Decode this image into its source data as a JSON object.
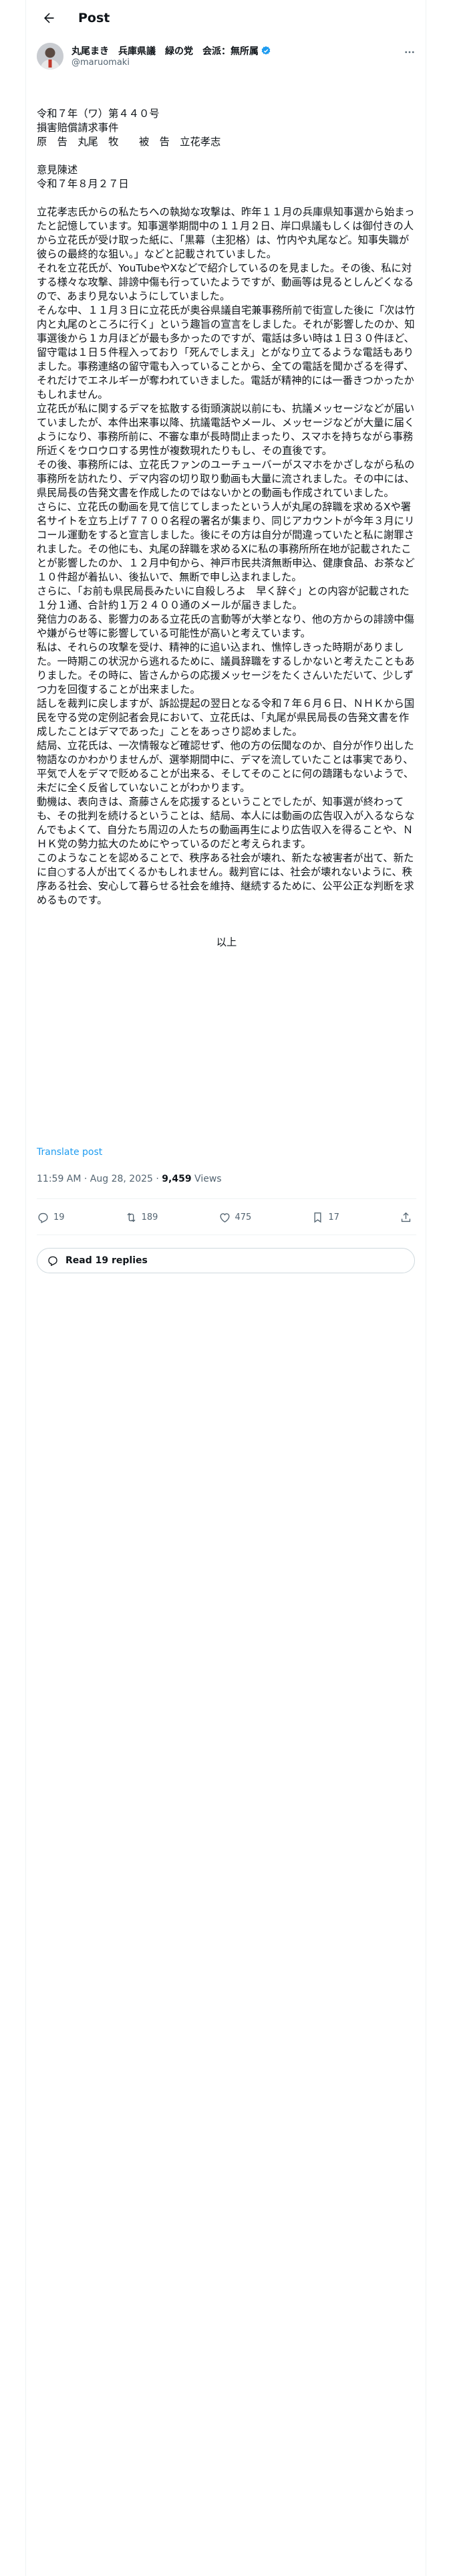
{
  "header": {
    "title": "Post"
  },
  "author": {
    "display_name": "丸尾まき　兵庫県議　緑の党　会派：無所属",
    "handle": "@maruomaki"
  },
  "post": {
    "text": "令和７年（ワ）第４４０号\n損害賠償請求事件\n原　告　丸尾　牧　　被　告　立花孝志\n\n意見陳述\n令和７年８月２７日\n\n立花孝志氏からの私たちへの執拗な攻撃は、昨年１１月の兵庫県知事選から始まったと記憶しています。知事選挙期間中の１１月２日、岸口県議もしくは御付きの人から立花氏が受け取った紙に、「黒幕（主犯格）は、竹内や丸尾など。知事失職が彼らの最終的な狙い。」などと記載されていました。\nそれを立花氏が、YouTubeやXなどで紹介しているのを見ました。その後、私に対する様々な攻撃、誹謗中傷も行っていたようですが、動画等は見るとしんどくなるので、あまり見ないようにしていました。\nそんな中、１１月３日に立花氏が奥谷県議自宅兼事務所前で街宣した後に「次は竹内と丸尾のところに行く」という趣旨の宣言をしました。それが影響したのか、知事選後から１カ月ほどが最も多かったのですが、電話は多い時は１日３０件ほど、留守電は１日５件程入っており「死んでしまえ」とがなり立てるような電話もありました。事務連絡の留守電も入っていることから、全ての電話を聞かざるを得ず、それだけでエネルギーが奪われていきました。電話が精神的には一番きつかったかもしれません。\n立花氏が私に関するデマを拡散する街頭演説以前にも、抗議メッセージなどが届いていましたが、本件出来事以降、抗議電話やメール、メッセージなどが大量に届くようになり、事務所前に、不審な車が長時間止まったり、スマホを持ちながら事務所近くをウロウロする男性が複数現れたりもし、その直後です。\nその後、事務所には、立花氏ファンのユーチューバーがスマホをかざしながら私の事務所を訪れたり、デマ内容の切り取り動画も大量に流されました。その中には、県民局長の告発文書を作成したのではないかとの動画も作成されていました。\nさらに、立花氏の動画を見て信じてしまったという人が丸尾の辞職を求めるXや署名サイトを立ち上げ７７００名程の署名が集まり、同じアカウントが今年３月にリコール運動をすると宣言しました。後にその方は自分が間違っていたと私に謝罪されました。その他にも、丸尾の辞職を求めるXに私の事務所所在地が記載されたことが影響したのか、１２月中旬から、神戸市民共済無断申込、健康食品、お茶など１０件超が着払い、後払いで、無断で申し込まれました。\nさらに、「お前も県民局長みたいに自殺しろよ　早く辞ぐ」との内容が記載された１分１通、合計約１万２４００通のメールが届きました。\n発信力のある、影響力のある立花氏の言動等が大挙となり、他の方からの誹謗中傷や嫌がらせ等に影響している可能性が高いと考えています。\n私は、それらの攻撃を受け、精神的に追い込まれ、憔悴しきった時期がありました。一時期この状況から逃れるために、議員辞職をするしかないと考えたこともありました。その時に、皆さんからの応援メッセージをたくさんいただいて、少しずつ力を回復することが出来ました。\n話しを裁判に戻しますが、訴訟提起の翌日となる令和７年６月６日、ＮＨＫから国民を守る党の定例記者会見において、立花氏は、「丸尾が県民局長の告発文書を作成したことはデマであった」ことをあっさり認めました。\n結局、立花氏は、一次情報など確認せず、他の方の伝聞なのか、自分が作り出した物語なのかわかりませんが、選挙期間中に、デマを流していたことは事実であり、平気で人をデマで貶めることが出来る、そしてそのことに何の躊躇もないようで、未だに全く反省していないことがわかります。\n動機は、表向きは、斎藤さんを応援するということでしたが、知事選が終わっても、その批判を続けるということは、結局、本人には動画の広告収入が入るならなんでもよくて、自分たち周辺の人たちの動画再生により広告収入を得ることや、ＮＨＫ党の勢力拡大のためにやっているのだと考えられます。\nこのようなことを認めることで、秩序ある社会が壊れ、新たな被害者が出て、新たに自○する人が出てくるかもしれません。裁判官には、社会が壊れないように、秩序ある社会、安心して暮らせる社会を維持、継続するために、公平公正な判断を求めるものです。",
    "end_mark": "以上"
  },
  "translate_label": "Translate post",
  "meta": {
    "timestamp": "11:59 AM · Aug 28, 2025",
    "separator": " · ",
    "views_count": "9,459",
    "views_label": " Views"
  },
  "actions": {
    "replies": "19",
    "reposts": "189",
    "likes": "475",
    "bookmarks": "17"
  },
  "read_replies_label": "Read 19 replies",
  "colors": {
    "accent": "#1d9bf0",
    "secondary_text": "#536471",
    "border": "#eff3f4"
  },
  "icons": [
    "back-arrow-icon",
    "verified-badge-icon",
    "more-options-icon",
    "reply-icon",
    "repost-icon",
    "like-icon",
    "bookmark-icon",
    "share-icon",
    "speech-bubble-icon"
  ]
}
